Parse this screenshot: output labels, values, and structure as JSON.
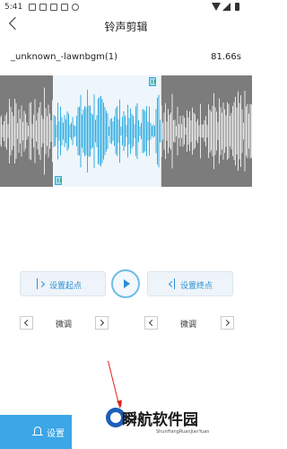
{
  "status": {
    "time": "5:41"
  },
  "header": {
    "title": "铃声剪辑"
  },
  "file": {
    "name": "_unknown_-lawnbgm(1)",
    "duration": "81.66s"
  },
  "waveform": {
    "selected_color": "#37aee2",
    "background_color": "#7c7c7c",
    "selection_start": 0.21,
    "selection_end": 0.64
  },
  "controls": {
    "set_start_label": "设置起点",
    "set_end_label": "设置终点"
  },
  "fine_tune": {
    "left_label": "微调",
    "right_label": "微调"
  },
  "footer": {
    "settings_label": "设置"
  },
  "watermark": {
    "title": "瞬航软件园",
    "subtitle": "ShunHangRuanJianYuan"
  }
}
